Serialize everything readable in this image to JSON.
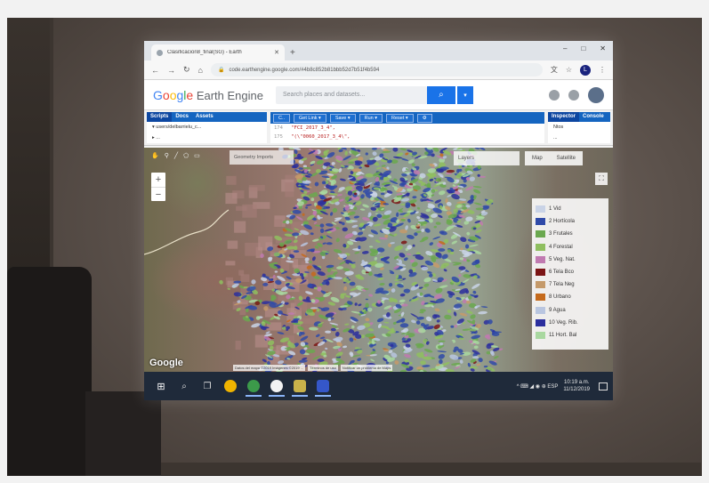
{
  "browser": {
    "tab_title": "Clasificacion8_final(SG) - Earth",
    "address": "code.earthengine.google.com/#4b8c852b81bbb52d7b51f4b594",
    "window_controls": [
      "–",
      "□",
      "✕"
    ]
  },
  "gee": {
    "logo_google": [
      "G",
      "o",
      "o",
      "g",
      "l",
      "e"
    ],
    "logo_product": " Earth Engine",
    "search_placeholder": "Search places and datasets..."
  },
  "left_panel": {
    "tabs": [
      "Scripts",
      "Docs",
      "Assets"
    ],
    "tree_lines": [
      "▾ users/delbarrielu_c...",
      "  ▸ ..."
    ]
  },
  "editor": {
    "tools": [
      "C..",
      "Get Link ▾",
      "Save ▾",
      "Run ▾",
      "Reset ▾"
    ],
    "code_lines": [
      {
        "ln": "174",
        "text": "  \"FCI_2017_3_4\","
      },
      {
        "ln": "175",
        "text": "  \"(\\\"0060_2017_3_4\\\","
      }
    ]
  },
  "right_panel": {
    "tabs": [
      "Inspector",
      "Console"
    ],
    "lines": [
      "Ntos",
      "..."
    ]
  },
  "map": {
    "geometry_label": "Geometry Imports",
    "layers_label": "Layers",
    "map_types": [
      "Map",
      "Satellite"
    ],
    "zoom_in": "+",
    "zoom_out": "−",
    "watermark": "Google",
    "attribution": [
      "Datos del mapa ©2019 Imágenes ©2019 ...",
      "Términos de uso",
      "Notificar un problema de Maps"
    ],
    "legend": [
      {
        "label": "1 Vid",
        "color": "#c9d3e6"
      },
      {
        "label": "2 Hortícola",
        "color": "#2f4aa8"
      },
      {
        "label": "3 Frutales",
        "color": "#6aa84f"
      },
      {
        "label": "4 Forestal",
        "color": "#8fbf5f"
      },
      {
        "label": "5 Veg. Nat.",
        "color": "#c07ab0"
      },
      {
        "label": "6 Tela Bco",
        "color": "#7b1515"
      },
      {
        "label": "7 Tela Neg",
        "color": "#c59a6a"
      },
      {
        "label": "8 Urbano",
        "color": "#c56a1c"
      },
      {
        "label": "9 Agua",
        "color": "#b9c6e0"
      },
      {
        "label": "10 Veg. Rib.",
        "color": "#2b2f9e"
      },
      {
        "label": "11 Hort. Bal",
        "color": "#a9d8a0"
      }
    ]
  },
  "taskbar": {
    "start": "⊞",
    "search": "⌕",
    "task_view": "❐",
    "tray": "^ ⌨ ◢ ◉ ⊕ ESP",
    "time": "10:19 a.m.",
    "date": "11/12/2019"
  }
}
